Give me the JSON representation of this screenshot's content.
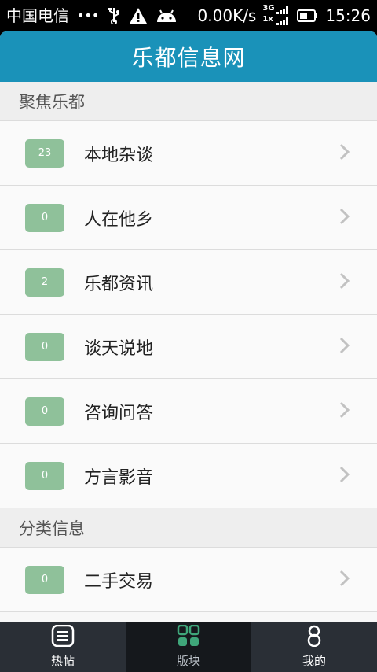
{
  "status_bar": {
    "carrier": "中国电信",
    "dots": "•••",
    "speed": "0.00K/s",
    "network_top": "3G",
    "network_bottom": "1x",
    "time": "15:26",
    "icons": [
      "usb-icon",
      "warning-icon",
      "android-icon",
      "signal-icon",
      "battery-icon"
    ]
  },
  "header": {
    "title": "乐都信息网",
    "color": "#1a92b9"
  },
  "sections": [
    {
      "title": "聚焦乐都",
      "items": [
        {
          "count": "23",
          "label": "本地杂谈"
        },
        {
          "count": "0",
          "label": "人在他乡"
        },
        {
          "count": "2",
          "label": "乐都资讯"
        },
        {
          "count": "0",
          "label": "谈天说地"
        },
        {
          "count": "0",
          "label": "咨询问答"
        },
        {
          "count": "0",
          "label": "方言影音"
        }
      ]
    },
    {
      "title": "分类信息",
      "items": [
        {
          "count": "0",
          "label": "二手交易"
        }
      ]
    }
  ],
  "bottom_nav": {
    "items": [
      {
        "label": "热帖",
        "icon": "list-icon",
        "active": false
      },
      {
        "label": "版块",
        "icon": "grid-icon",
        "active": true
      },
      {
        "label": "我的",
        "icon": "user-icon",
        "active": false
      }
    ]
  },
  "colors": {
    "badge": "#8fc19a",
    "nav_active_icon": "#3fa67a"
  }
}
